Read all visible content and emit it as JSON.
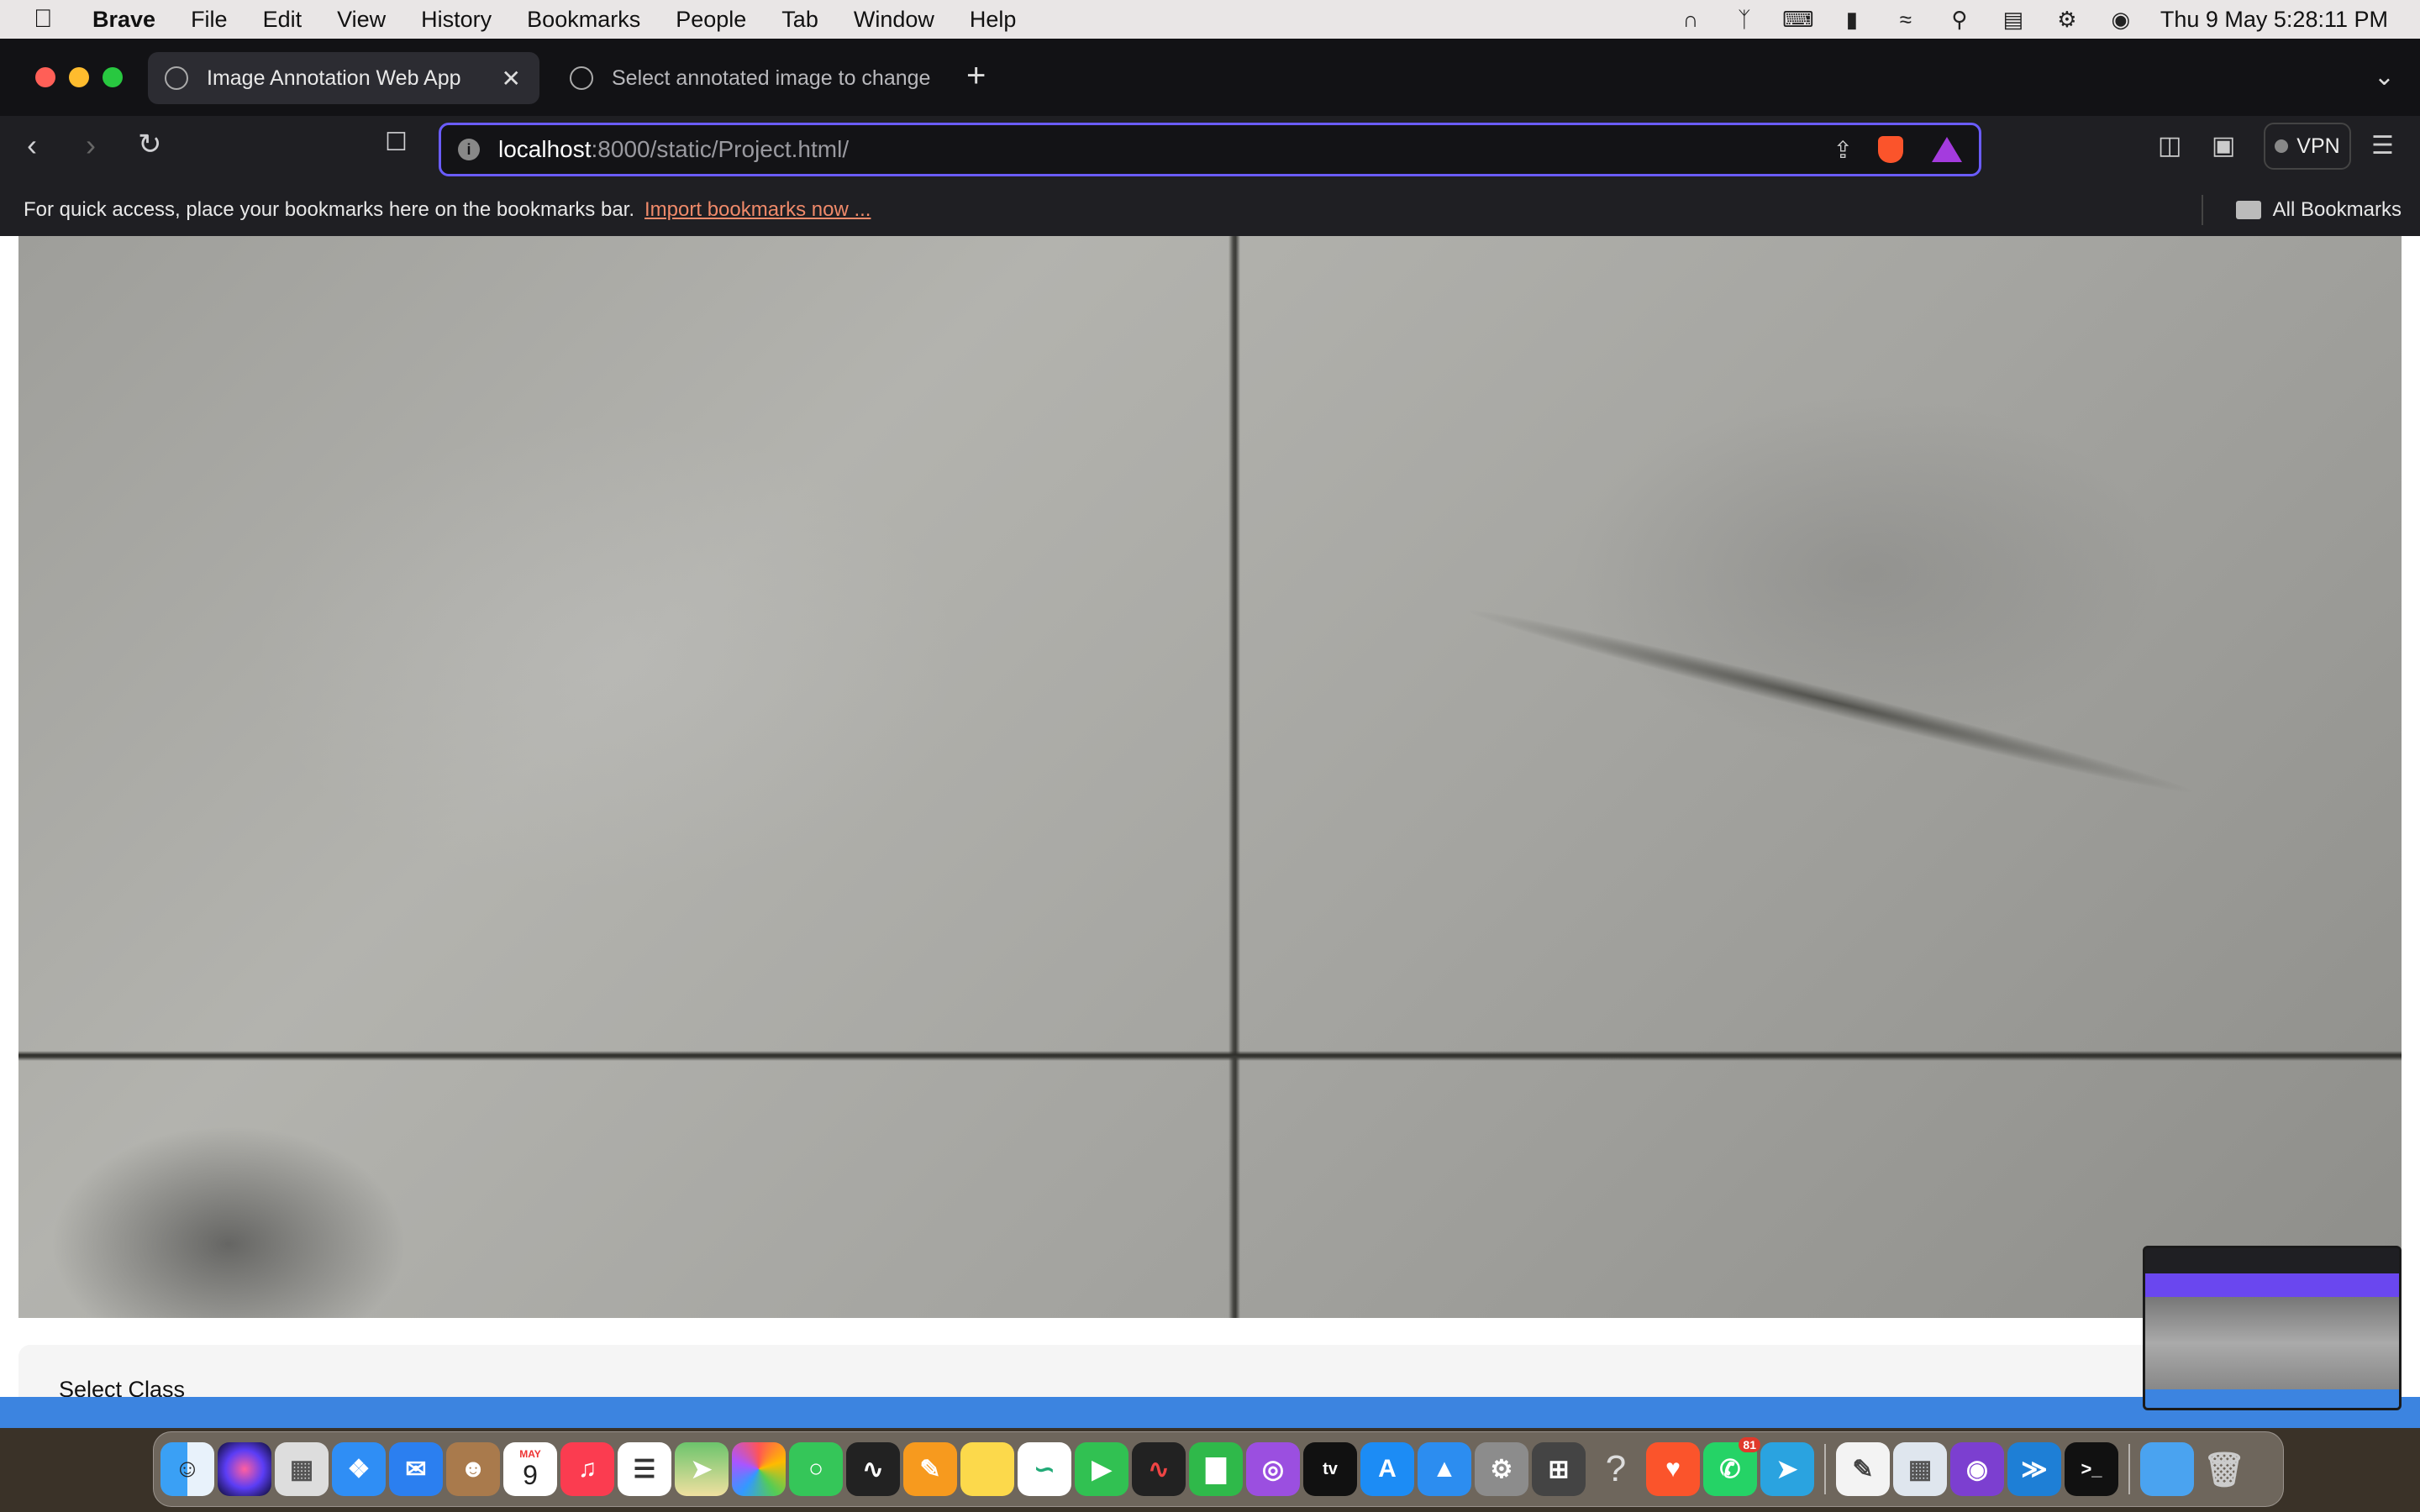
{
  "menubar": {
    "app_name": "Brave",
    "items": [
      "File",
      "Edit",
      "View",
      "History",
      "Bookmarks",
      "People",
      "Tab",
      "Window",
      "Help"
    ],
    "clock": "Thu 9 May  5:28:11 PM"
  },
  "tabs": [
    {
      "title": "Image Annotation Web App"
    },
    {
      "title": "Select annotated image to change"
    }
  ],
  "url": {
    "host": "localhost",
    "path": ":8000/static/Project.html/"
  },
  "vpn_label": "VPN",
  "bookmarks_bar": {
    "hint": "For quick access, place your bookmarks here on the bookmarks bar.",
    "import_link": "Import bookmarks now ...",
    "all_bookmarks": "All Bookmarks"
  },
  "page": {
    "select_class_label": "Select Class"
  },
  "dock": {
    "apps": [
      "Finder",
      "Siri",
      "Launchpad",
      "Safari",
      "Mail",
      "Contacts",
      "Calendar",
      "Music",
      "Reminders",
      "Maps",
      "Photos",
      "Messages",
      "Voice Memos",
      "Pages",
      "Notes",
      "Freeform",
      "FaceTime",
      "Audio",
      "Numbers",
      "Podcasts",
      "TV",
      "App Store",
      "Keynote",
      "System Settings",
      "Calculator",
      "Help",
      "Brave",
      "WhatsApp",
      "Telegram",
      "TextEdit",
      "Preview",
      "GitHub Desktop",
      "VS Code",
      "Terminal",
      "Files",
      "Trash"
    ],
    "calendar_month": "MAY",
    "calendar_day": "9",
    "whatsapp_badge": "81"
  }
}
